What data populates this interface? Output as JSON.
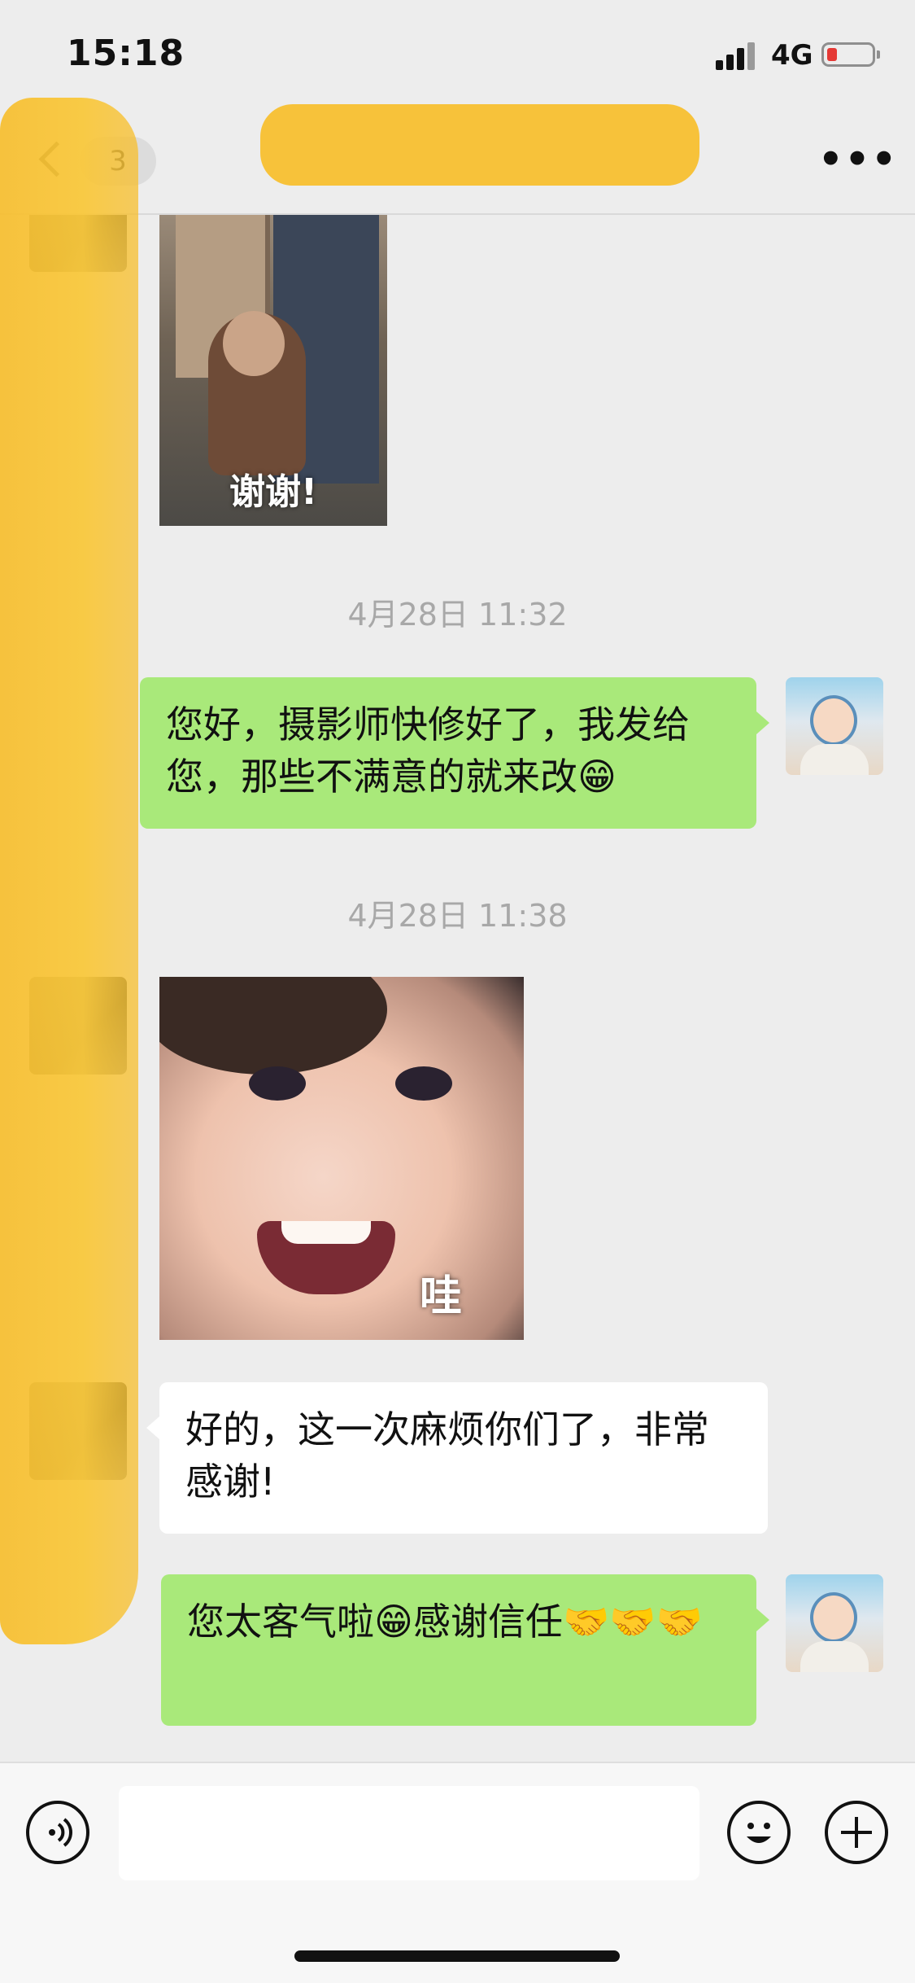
{
  "status_bar": {
    "time": "15:18",
    "network": "4G",
    "battery_level": 0.1
  },
  "nav": {
    "back_count": "3",
    "title": "",
    "more_label": "•••"
  },
  "messages": {
    "sticker_1_caption": "谢谢!",
    "timestamp_1": "4月28日 11:32",
    "sent_1": "您好，摄影师快修好了，我发给您，那些不满意的就来改😁",
    "timestamp_2": "4月28日 11:38",
    "sticker_2_caption": "哇",
    "received_1": "好的，这一次麻烦你们了，非常感谢!",
    "sent_2": "您太客气啦😁感谢信任🤝🤝🤝"
  },
  "input_bar": {
    "placeholder": ""
  },
  "colors": {
    "sent_bubble": "#a9e97a",
    "received_bubble": "#ffffff",
    "background": "#ededed",
    "redaction": "#f7be2e"
  },
  "icons": {
    "voice": "voice-icon",
    "emoji": "emoji-icon",
    "plus": "plus-icon",
    "more": "more-icon",
    "back": "chevron-left-icon"
  }
}
